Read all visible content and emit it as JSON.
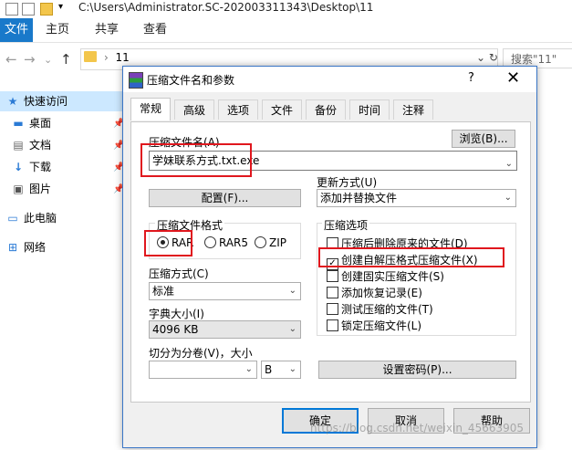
{
  "explorer": {
    "title_path": "C:\\Users\\Administrator.SC-202003311343\\Desktop\\11",
    "ribbon_tabs": [
      "文件",
      "主页",
      "共享",
      "查看"
    ],
    "address_crumb": "11",
    "search_placeholder": "搜索\"11\"",
    "nav_items": [
      {
        "label": "快速访问",
        "icon": "star-icon"
      },
      {
        "label": "桌面",
        "icon": "desktop-icon"
      },
      {
        "label": "文档",
        "icon": "document-icon"
      },
      {
        "label": "下载",
        "icon": "download-icon"
      },
      {
        "label": "图片",
        "icon": "pictures-icon"
      },
      {
        "label": "此电脑",
        "icon": "computer-icon"
      },
      {
        "label": "网络",
        "icon": "network-icon"
      }
    ]
  },
  "dialog": {
    "title": "压缩文件名和参数",
    "help": "?",
    "close": "✕",
    "tabs": [
      "常规",
      "高级",
      "选项",
      "文件",
      "备份",
      "时间",
      "注释"
    ],
    "active_tab": "常规",
    "archive_name_label": "压缩文件名(A)",
    "browse_button": "浏览(B)...",
    "archive_name_value": "学妹联系方式.txt.exe",
    "update_mode_label": "更新方式(U)",
    "update_mode_value": "添加并替换文件",
    "profiles_button": "配置(F)...",
    "format_group_label": "压缩文件格式",
    "formats": [
      {
        "label": "RAR",
        "selected": true
      },
      {
        "label": "RAR5",
        "selected": false
      },
      {
        "label": "ZIP",
        "selected": false
      }
    ],
    "compression_method_label": "压缩方式(C)",
    "compression_method_value": "标准",
    "dictionary_label": "字典大小(I)",
    "dictionary_value": "4096 KB",
    "split_label": "切分为分卷(V)，大小",
    "split_value": "",
    "split_unit": "B",
    "options_group_label": "压缩选项",
    "options": [
      {
        "label": "压缩后删除原来的文件(D)",
        "checked": false
      },
      {
        "label": "创建自解压格式压缩文件(X)",
        "checked": true
      },
      {
        "label": "创建固实压缩文件(S)",
        "checked": false
      },
      {
        "label": "添加恢复记录(E)",
        "checked": false
      },
      {
        "label": "测试压缩的文件(T)",
        "checked": false
      },
      {
        "label": "锁定压缩文件(L)",
        "checked": false
      }
    ],
    "password_button": "设置密码(P)...",
    "ok_button": "确定",
    "cancel_button": "取消",
    "help_button": "帮助"
  },
  "watermark": "https://blog.csdn.net/weixin_45663905",
  "colors": {
    "accent": "#1979ca",
    "highlight": "#e0171e",
    "selected_nav": "#cce8ff"
  }
}
